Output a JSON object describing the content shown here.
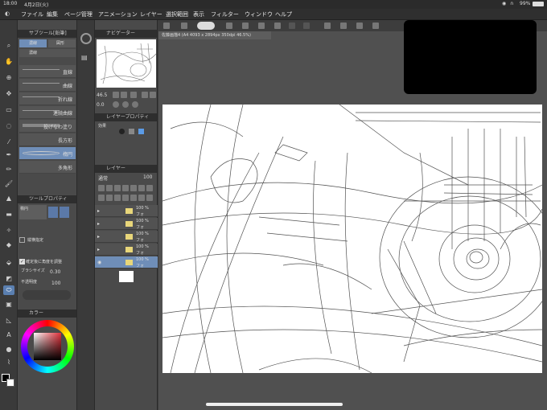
{
  "status": {
    "time": "18:00",
    "date": "4月2日(火)",
    "battery": "99%",
    "wifi_icon": "wifi-icon",
    "headphone_icon": "headphones-icon"
  },
  "menu": [
    "ファイル",
    "編集",
    "ページ管理",
    "アニメーション",
    "レイヤー",
    "選択範囲",
    "表示",
    "フィルター",
    "ウィンドウ",
    "ヘルプ"
  ],
  "subtool": {
    "title": "サブツール[鉛筆]",
    "groups": [
      "濃線",
      "図形"
    ],
    "items": [
      "直線",
      "曲線",
      "折れ線",
      "連続曲線",
      "投げなわ塗り",
      "長方形",
      "楕円",
      "多角形"
    ],
    "selected_index": 6,
    "group_selected": "濃線"
  },
  "tool_property": {
    "title": "ツールプロパティ",
    "preview_label": "楕円",
    "aspect_label": "縦横指定",
    "fix_angle_label": "確定後に角度を調整",
    "brush_size_label": "ブラシサイズ",
    "brush_size_value": "0.30",
    "opacity_label": "不透明度",
    "opacity_value": "100"
  },
  "color": {
    "title": "カラー"
  },
  "navigator": {
    "title": "ナビゲーター",
    "zoom_value": "46.5",
    "rotate_value": "0.0"
  },
  "layer_property": {
    "title": "レイヤープロパティ",
    "effect_label": "効果"
  },
  "layers": {
    "title": "レイヤー",
    "blend_mode": "通常",
    "opacity": "100",
    "rows": [
      {
        "pct": "100 %",
        "mode": "フォ"
      },
      {
        "pct": "100 %",
        "mode": "フォ"
      },
      {
        "pct": "100 %",
        "mode": "フォ"
      },
      {
        "pct": "100 %",
        "mode": "フォ"
      },
      {
        "pct": "100 %",
        "mode": "フォ"
      }
    ],
    "selected_index": 4
  },
  "document": {
    "tab_label": "佐藤画描4 (A4 4093 x 2894px 350dpi 46.5%)"
  },
  "colors": {
    "accent": "#6f8eb8",
    "folder": "#e8d67a"
  }
}
